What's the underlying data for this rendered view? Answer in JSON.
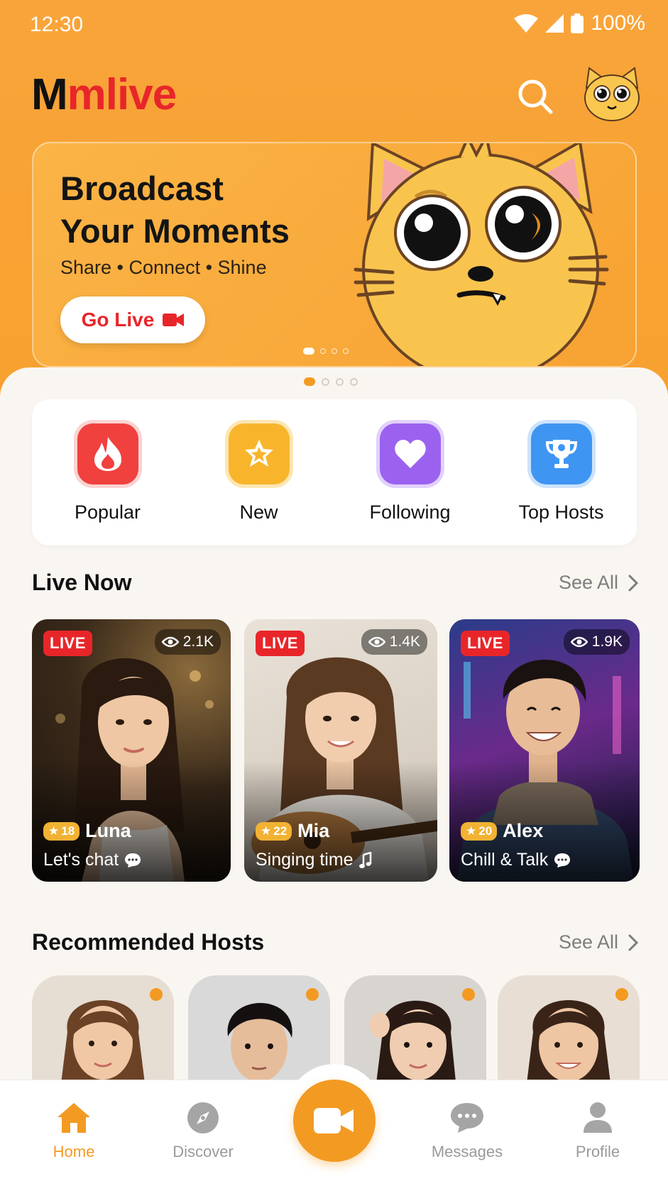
{
  "status_bar": {
    "time": "12:30",
    "battery": "100%"
  },
  "header": {
    "logo_first": "M",
    "logo_rest": "mlive"
  },
  "banner": {
    "title_line1": "Broadcast",
    "title_line2": "Your Moments",
    "subtitle": "Share • Connect • Shine",
    "cta_label": "Go Live"
  },
  "categories": [
    {
      "label": "Popular",
      "icon": "flame-icon",
      "color": "#f0413e"
    },
    {
      "label": "New",
      "icon": "star-icon",
      "color": "#f8b52c"
    },
    {
      "label": "Following",
      "icon": "heart-icon",
      "color": "#9b62f0"
    },
    {
      "label": "Top Hosts",
      "icon": "trophy-icon",
      "color": "#3f95f2"
    }
  ],
  "live_now": {
    "title": "Live Now",
    "see_all": "See All",
    "cards": [
      {
        "badge": "LIVE",
        "viewers": "2.1K",
        "level": "18",
        "name": "Luna",
        "caption": "Let's chat",
        "caption_icon": "chat-bubble-icon"
      },
      {
        "badge": "LIVE",
        "viewers": "1.4K",
        "level": "22",
        "name": "Mia",
        "caption": "Singing time",
        "caption_icon": "music-note-icon"
      },
      {
        "badge": "LIVE",
        "viewers": "1.9K",
        "level": "20",
        "name": "Alex",
        "caption": "Chill & Talk",
        "caption_icon": "chat-bubble-icon"
      }
    ]
  },
  "recommended": {
    "title": "Recommended Hosts",
    "see_all": "See All"
  },
  "bottom_nav": {
    "items": [
      {
        "label": "Home",
        "icon": "home-icon",
        "active": true
      },
      {
        "label": "Discover",
        "icon": "compass-icon",
        "active": false
      },
      {
        "label": "Messages",
        "icon": "messages-icon",
        "active": false
      },
      {
        "label": "Profile",
        "icon": "profile-icon",
        "active": false
      }
    ],
    "center_icon": "video-camera-icon"
  },
  "colors": {
    "brand_orange": "#f7a12f",
    "accent_red": "#e8262a",
    "active_orange": "#f39a22"
  }
}
